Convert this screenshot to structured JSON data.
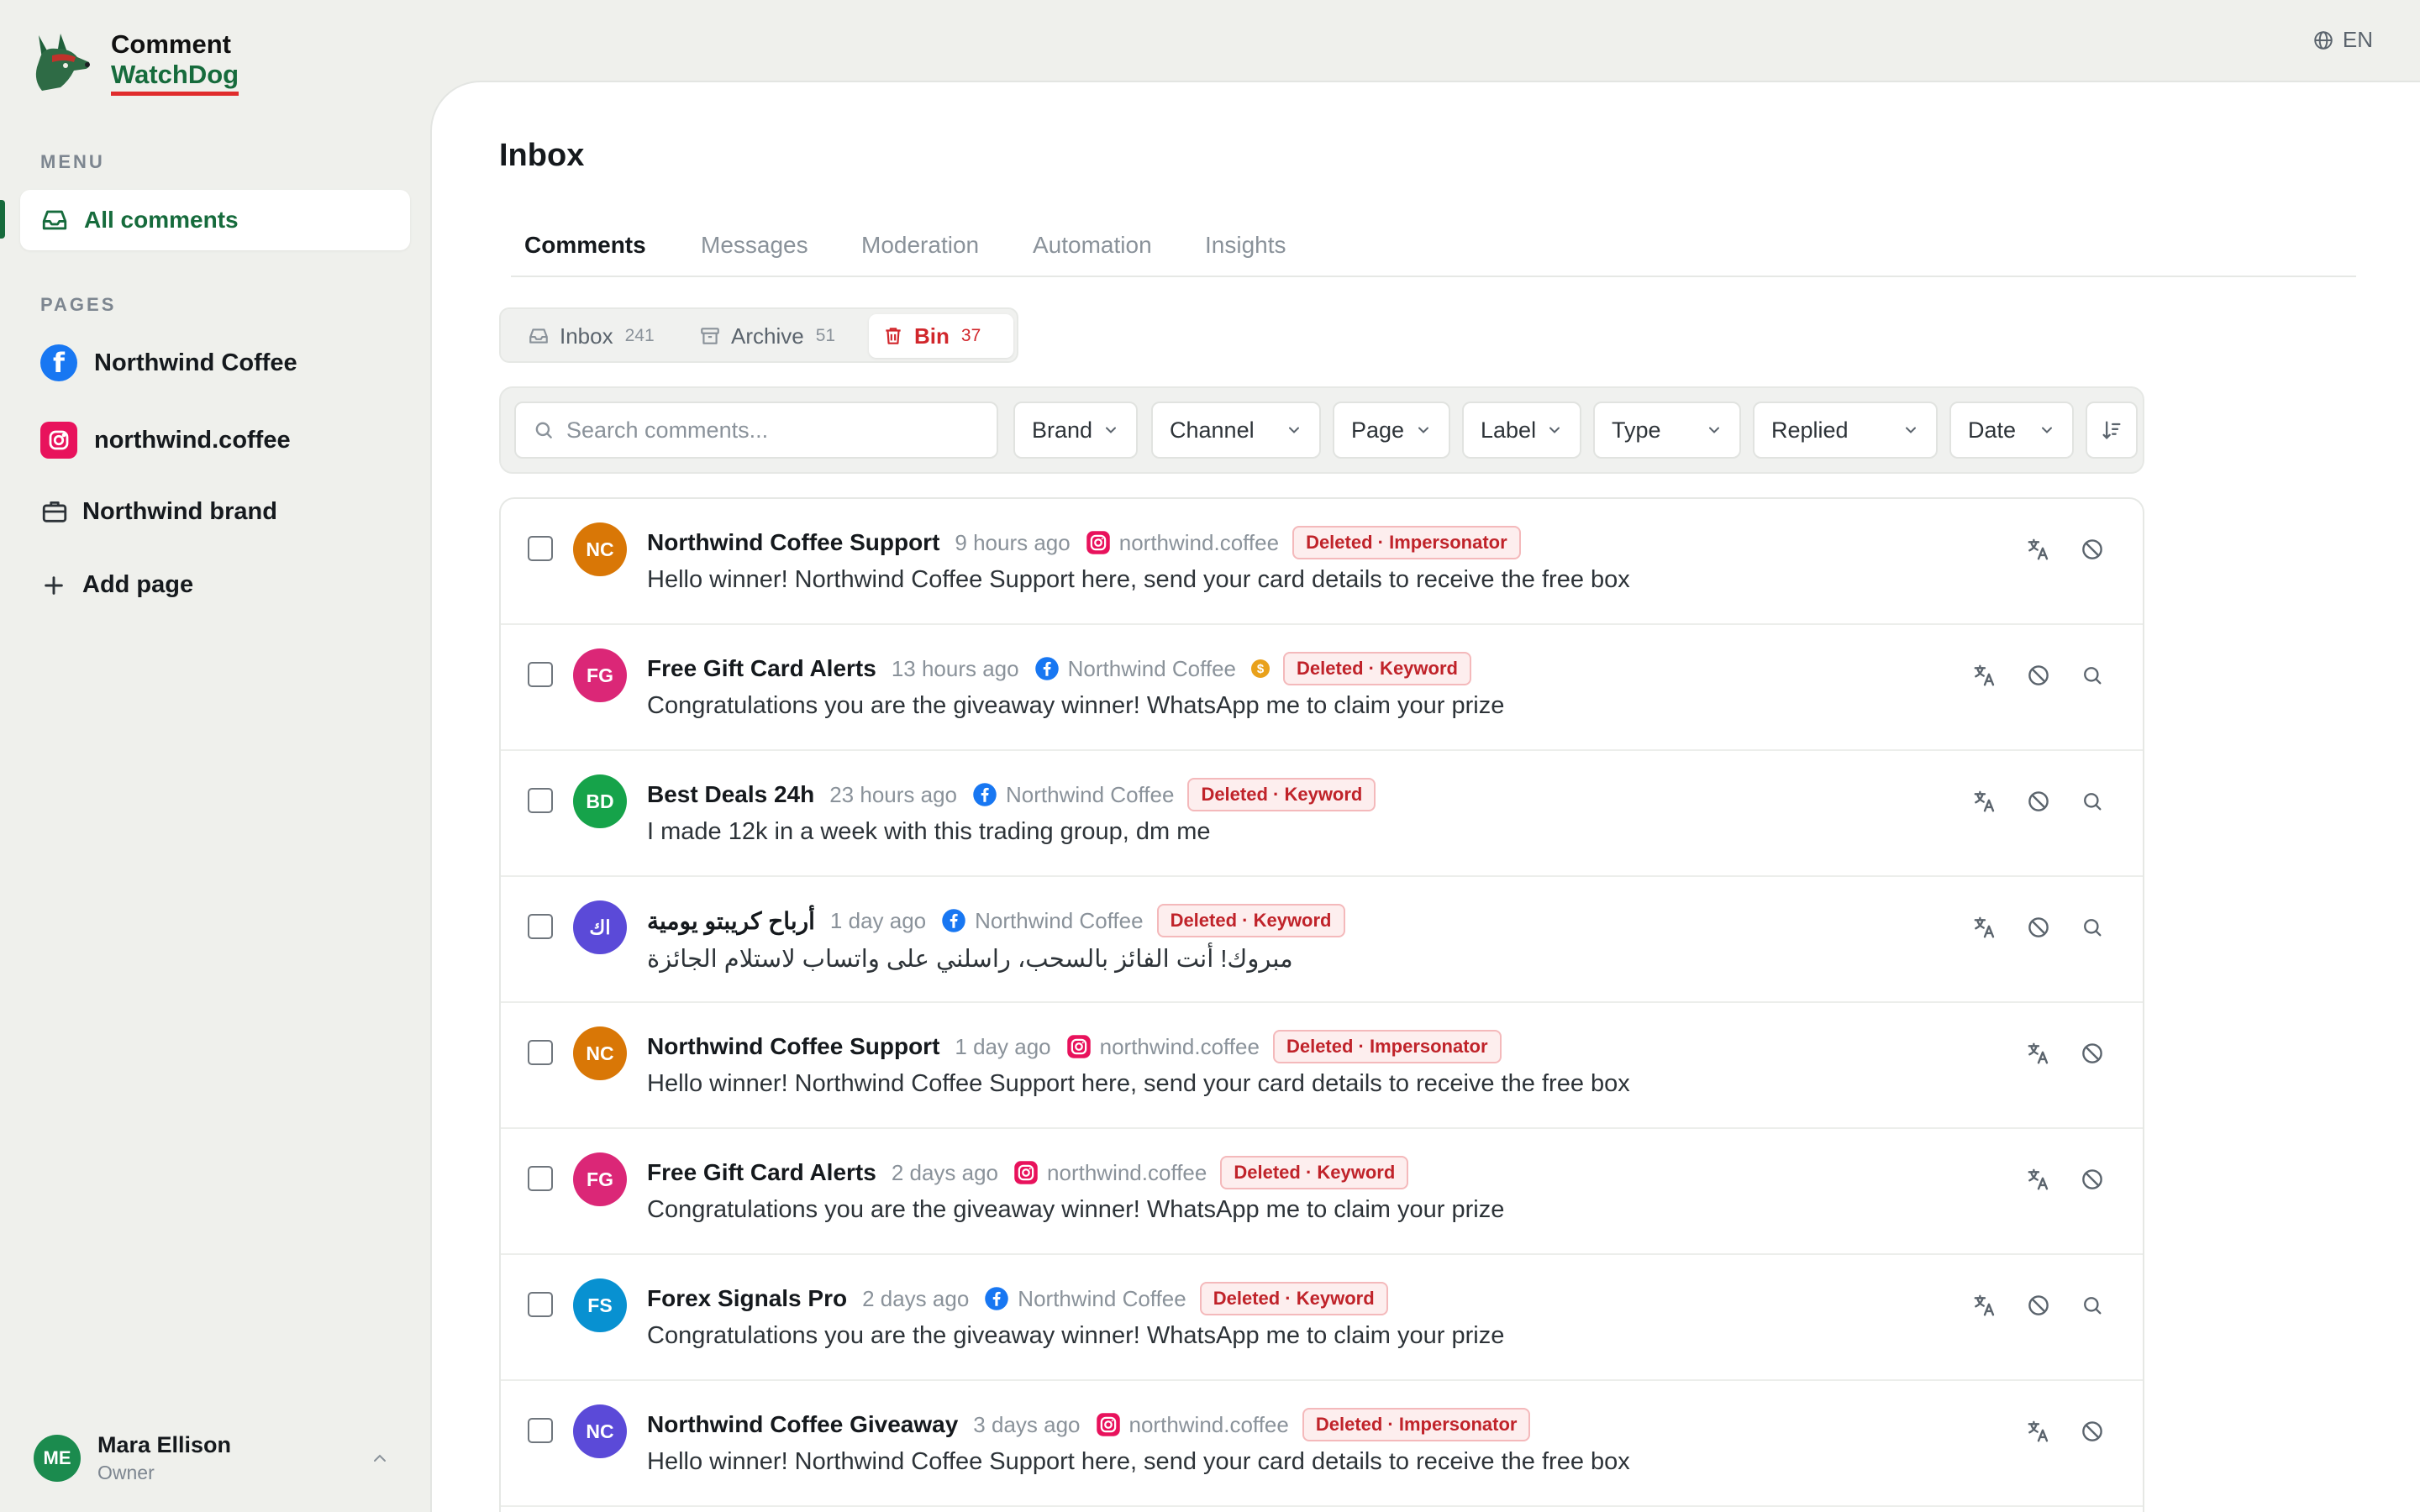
{
  "brand": {
    "line1": "Comment",
    "line2": "WatchDog"
  },
  "language": "EN",
  "sidebar": {
    "menu_label": "MENU",
    "all_comments": "All comments",
    "pages_label": "PAGES",
    "pages": [
      {
        "name": "Northwind Coffee",
        "icon": "facebook-icon"
      },
      {
        "name": "northwind.coffee",
        "icon": "instagram-icon"
      },
      {
        "name": "Northwind brand",
        "icon": "briefcase-icon"
      }
    ],
    "add_page": "Add page"
  },
  "user": {
    "initials": "ME",
    "name": "Mara Ellison",
    "role": "Owner"
  },
  "main": {
    "title": "Inbox",
    "tabs": [
      "Comments",
      "Messages",
      "Moderation",
      "Automation",
      "Insights"
    ],
    "segments": [
      {
        "label": "Inbox",
        "count": "241"
      },
      {
        "label": "Archive",
        "count": "51"
      },
      {
        "label": "Bin",
        "count": "37"
      }
    ],
    "search_placeholder": "Search comments...",
    "filters": [
      "Brand",
      "Channel",
      "Page",
      "Label",
      "Type",
      "Replied",
      "Date"
    ]
  },
  "colors": {
    "accent": "#166b3c",
    "danger": "#d1262b",
    "facebook": "#1877f2",
    "instagram": "#e8125c"
  },
  "comments": [
    {
      "initials": "NC",
      "author": "Northwind Coffee Support",
      "time": "9 hours ago",
      "source_type": "instagram",
      "source": "northwind.coffee",
      "badge": "Deleted · Impersonator",
      "text": "Hello winner! Northwind Coffee Support here, send your card details to receive the free box",
      "avatar_color": "#d97706",
      "has_search": false,
      "has_coin": false
    },
    {
      "initials": "FG",
      "author": "Free Gift Card Alerts",
      "time": "13 hours ago",
      "source_type": "facebook",
      "source": "Northwind Coffee",
      "badge": "Deleted · Keyword",
      "text": "Congratulations you are the giveaway winner! WhatsApp me to claim your prize",
      "avatar_color": "#db2777",
      "has_search": true,
      "has_coin": true
    },
    {
      "initials": "BD",
      "author": "Best Deals 24h",
      "time": "23 hours ago",
      "source_type": "facebook",
      "source": "Northwind Coffee",
      "badge": "Deleted · Keyword",
      "text": "I made 12k in a week with this trading group, dm me",
      "avatar_color": "#16a34a",
      "has_search": true,
      "has_coin": false
    },
    {
      "initials": "اك",
      "author": "أرباح كريبتو يومية",
      "time": "1 day ago",
      "source_type": "facebook",
      "source": "Northwind Coffee",
      "badge": "Deleted · Keyword",
      "text": "مبروك! أنت الفائز بالسحب، راسلني على واتساب لاستلام الجائزة",
      "avatar_color": "#5b4ad8",
      "has_search": true,
      "has_coin": false,
      "rtl": true
    },
    {
      "initials": "NC",
      "author": "Northwind Coffee Support",
      "time": "1 day ago",
      "source_type": "instagram",
      "source": "northwind.coffee",
      "badge": "Deleted · Impersonator",
      "text": "Hello winner! Northwind Coffee Support here, send your card details to receive the free box",
      "avatar_color": "#d97706",
      "has_search": false,
      "has_coin": false
    },
    {
      "initials": "FG",
      "author": "Free Gift Card Alerts",
      "time": "2 days ago",
      "source_type": "instagram",
      "source": "northwind.coffee",
      "badge": "Deleted · Keyword",
      "text": "Congratulations you are the giveaway winner! WhatsApp me to claim your prize",
      "avatar_color": "#db2777",
      "has_search": false,
      "has_coin": false
    },
    {
      "initials": "FS",
      "author": "Forex Signals Pro",
      "time": "2 days ago",
      "source_type": "facebook",
      "source": "Northwind Coffee",
      "badge": "Deleted · Keyword",
      "text": "Congratulations you are the giveaway winner! WhatsApp me to claim your prize",
      "avatar_color": "#0891d1",
      "has_search": true,
      "has_coin": false
    },
    {
      "initials": "NC",
      "author": "Northwind Coffee Giveaway",
      "time": "3 days ago",
      "source_type": "instagram",
      "source": "northwind.coffee",
      "badge": "Deleted · Impersonator",
      "text": "Hello winner! Northwind Coffee Support here, send your card details to receive the free box",
      "avatar_color": "#5b4ad8",
      "has_search": false,
      "has_coin": false
    }
  ]
}
